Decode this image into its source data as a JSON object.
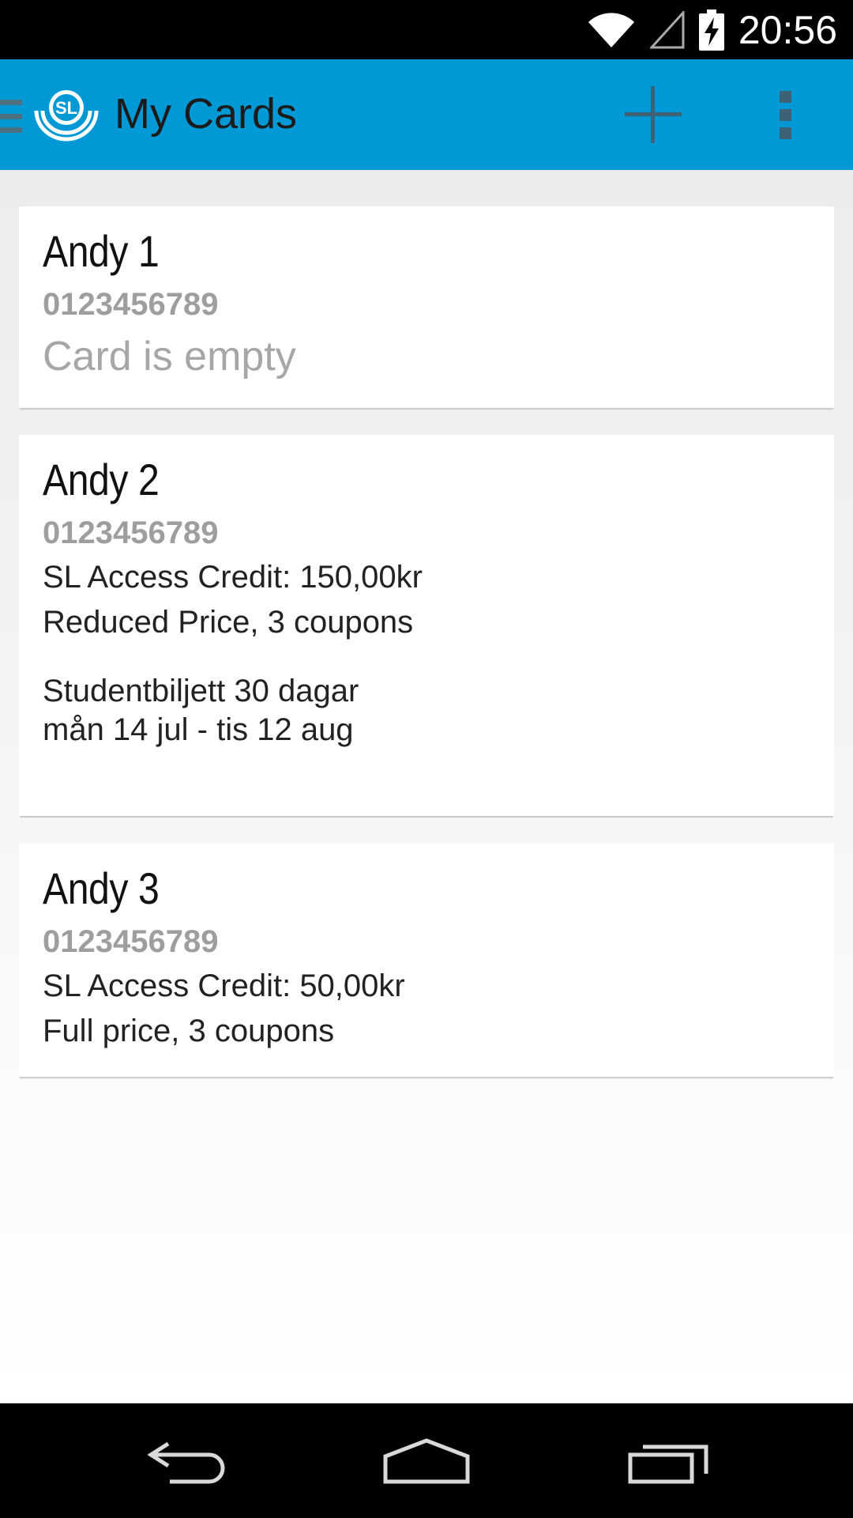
{
  "status_bar": {
    "time": "20:56",
    "icons": [
      "wifi-icon",
      "signal-icon",
      "battery-charging-icon"
    ]
  },
  "action_bar": {
    "title": "My Cards",
    "logo_text": "SL",
    "actions": [
      "add-icon",
      "overflow-menu-icon"
    ],
    "color": "#0099d6"
  },
  "cards": [
    {
      "name": "Andy 1",
      "number": "0123456789",
      "status": "Card is empty"
    },
    {
      "name": "Andy 2",
      "number": "0123456789",
      "credit": "SL Access Credit: 150,00kr",
      "coupons": "Reduced Price, 3 coupons",
      "ticket_name": "Studentbiljett 30 dagar",
      "ticket_period": "mån 14 jul - tis 12 aug"
    },
    {
      "name": "Andy 3",
      "number": "0123456789",
      "credit": "SL Access Credit: 50,00kr",
      "coupons": "Full price, 3 coupons"
    }
  ],
  "nav_bar": {
    "buttons": [
      "back-icon",
      "home-icon",
      "recent-apps-icon"
    ]
  }
}
